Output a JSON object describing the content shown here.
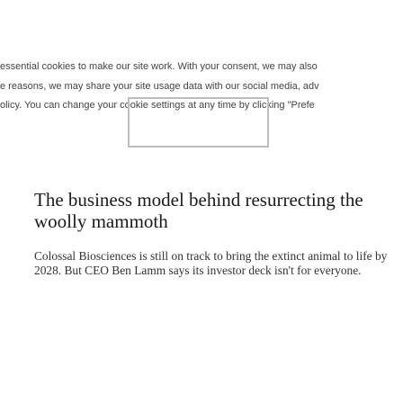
{
  "cookie_banner": {
    "lines": [
      "essential cookies to make our site work. With your consent, we may also",
      "e reasons, we may share your site usage data with our social media, adv",
      "olicy. You can change your cookie settings at any time by clicking \"Prefe"
    ]
  },
  "article": {
    "headline": "The business model behind resurrecting the woolly mammoth",
    "dek": "Colossal Biosciences is still on track to bring the extinct animal to life by 2028. But CEO Ben Lamm says its investor deck isn't for everyone."
  }
}
